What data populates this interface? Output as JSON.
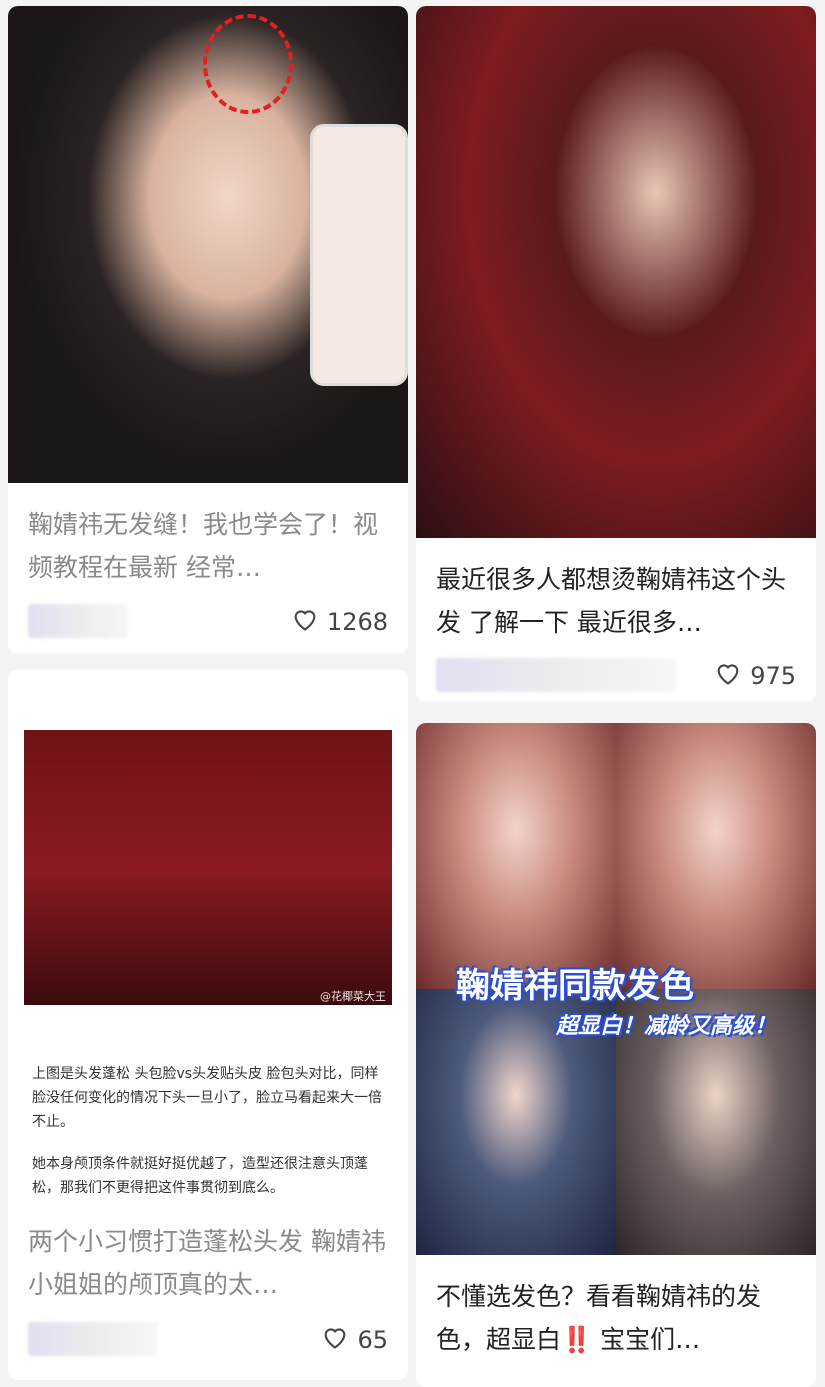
{
  "feed": [
    {
      "title": "鞠婧祎无发缝！我也学会了！视频教程在最新 经常…",
      "likes": "1268"
    },
    {
      "title": "最近很多人都想烫鞠婧祎这个头发 了解一下 最近很多…",
      "likes": "975"
    },
    {
      "title": "两个小习惯打造蓬松头发 鞠婧祎小姐姐的颅顶真的太…",
      "likes": "65",
      "image_text": {
        "watermark": "@花椰菜大王",
        "paragraph1": "上图是头发蓬松 头包脸vs头发贴头皮 脸包头对比，同样脸没任何变化的情况下头一旦小了，脸立马看起来大一倍不止。",
        "paragraph2": "她本身颅顶条件就挺好挺优越了，造型还很注意头顶蓬松，那我们不更得把这件事贯彻到底么。"
      }
    },
    {
      "title": "不懂选发色？看看鞠婧祎的发色，超显白‼️ 宝宝们…",
      "likes": "",
      "image_text": {
        "overlay_title": "鞠婧祎同款发色",
        "overlay_subtitle": "超显白！减龄又高级！"
      }
    }
  ],
  "icons": {
    "like": "heart-outline-icon"
  },
  "colors": {
    "background": "#f4f4f4",
    "card": "#ffffff",
    "text": "#222222",
    "accent_red": "#e02121"
  }
}
